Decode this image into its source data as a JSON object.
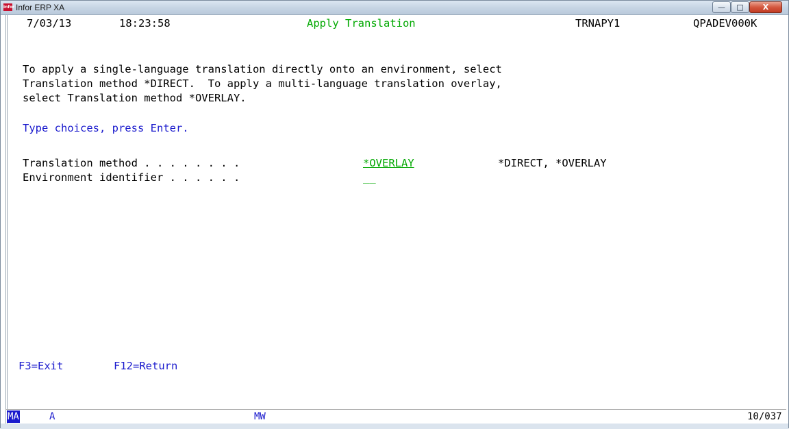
{
  "window": {
    "title": "Infor ERP XA",
    "icon_label": "infor",
    "buttons": {
      "minimize": "—",
      "maximize": "□",
      "close": "X"
    }
  },
  "header": {
    "date": "7/03/13",
    "time": "18:23:58",
    "screen_title": "Apply Translation",
    "program": "TRNAPY1",
    "device": "QPADEV000K"
  },
  "instructions": [
    "To apply a single-language translation directly onto an environment, select",
    "Translation method *DIRECT.  To apply a multi-language translation overlay,",
    "select Translation method *OVERLAY."
  ],
  "prompt": "Type choices, press Enter.",
  "fields": {
    "translation_method": {
      "label": "Translation method . . . . . . . .",
      "value": "*OVERLAY",
      "allowed": "*DIRECT, *OVERLAY"
    },
    "environment_identifier": {
      "label": "Environment identifier . . . . . .",
      "value": "__"
    }
  },
  "function_keys": {
    "f3": "F3=Exit",
    "f12": "F12=Return"
  },
  "status": {
    "session": "MA",
    "mode_a": "A",
    "indicator": "MW",
    "cursor_pos": "10/037"
  },
  "colors": {
    "green": "#00a800",
    "blue": "#1a1acd",
    "text": "#000000"
  }
}
